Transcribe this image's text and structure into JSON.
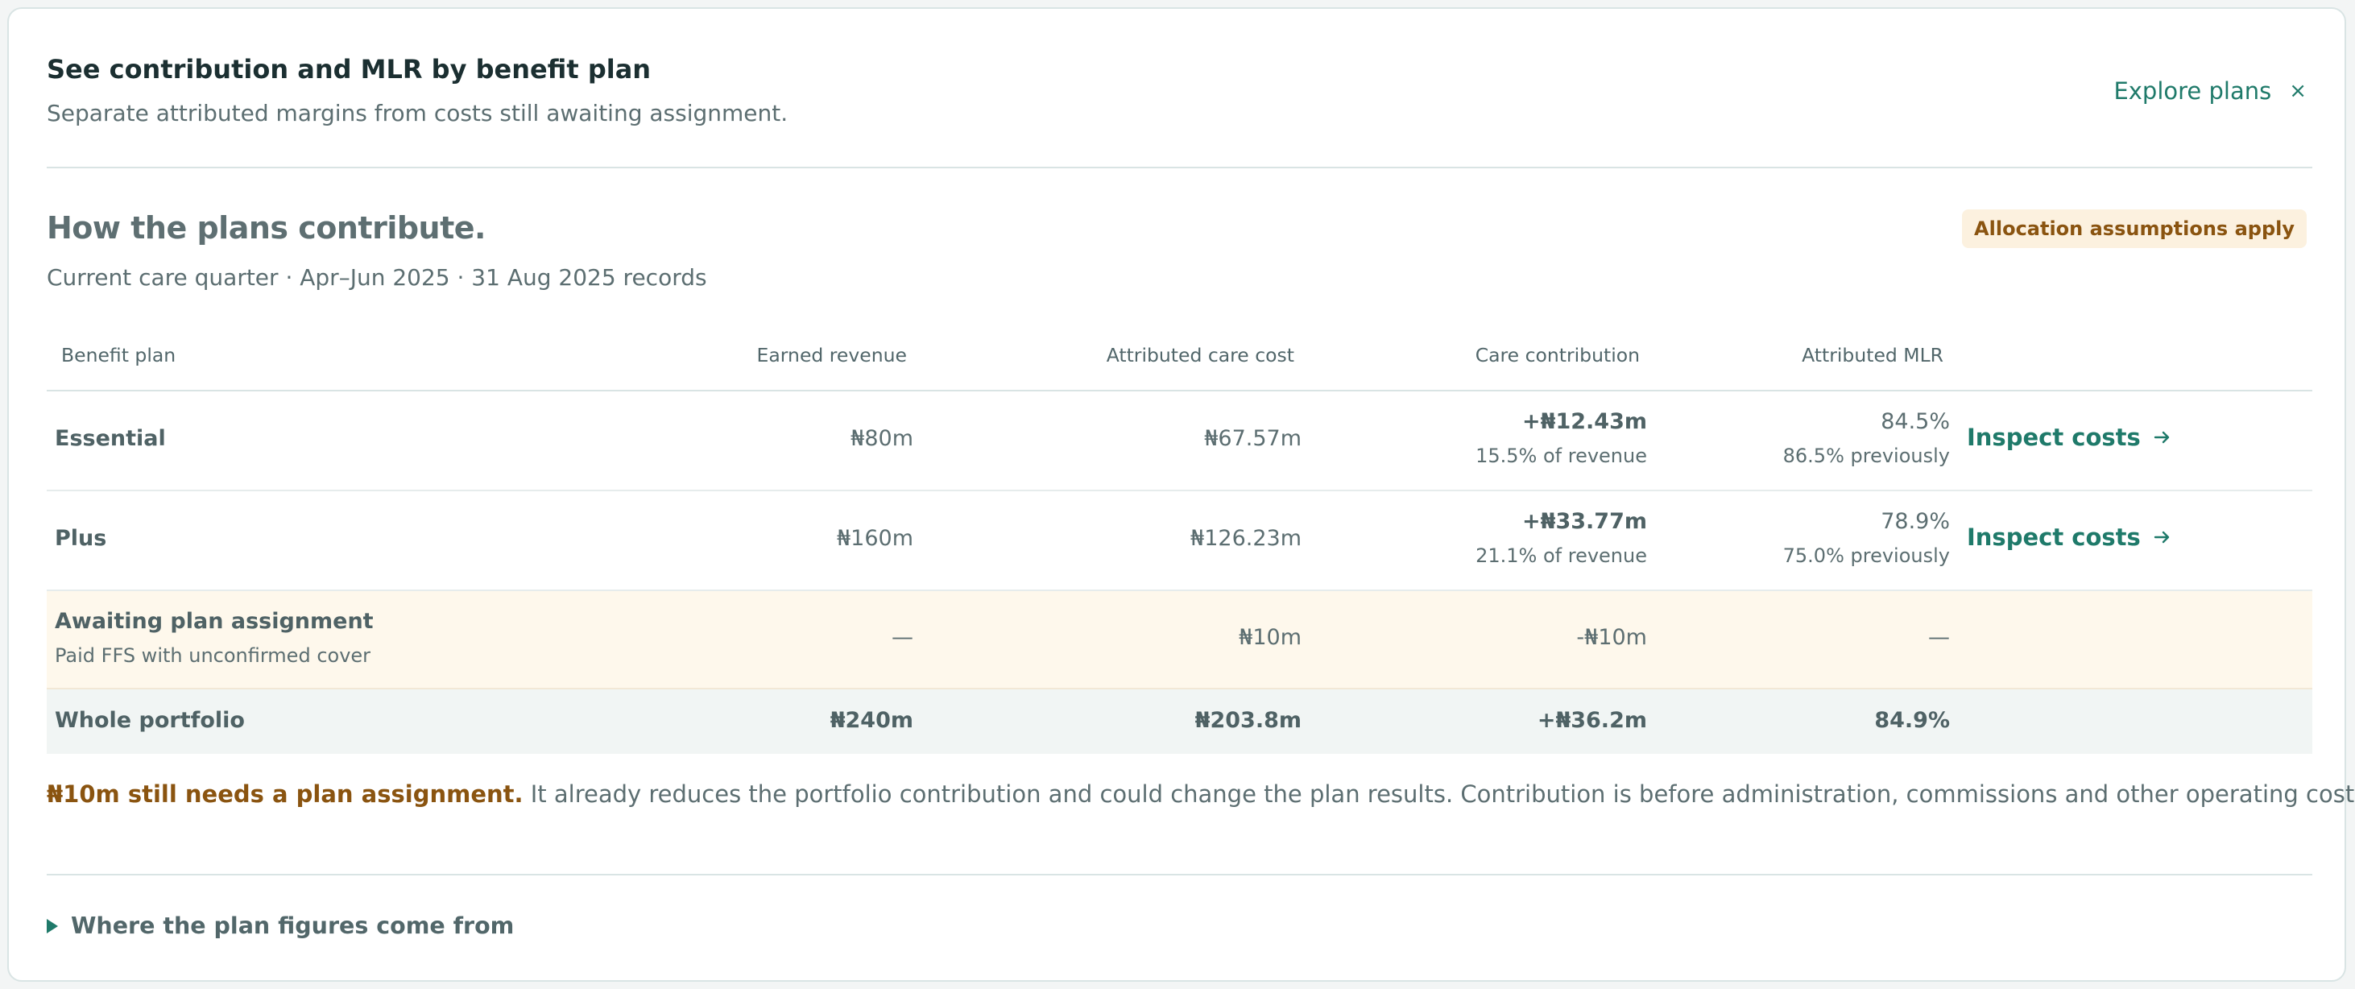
{
  "header": {
    "title": "See contribution and MLR by benefit plan",
    "subtitle": "Separate attributed margins from costs still awaiting assignment.",
    "explore_label": "Explore plans",
    "close_glyph": "×"
  },
  "section": {
    "title": "How the plans contribute.",
    "subtitle": "Current care quarter · Apr–Jun 2025 · 31 Aug 2025 records",
    "badge": "Allocation assumptions apply"
  },
  "table": {
    "columns": [
      "Benefit plan",
      "Earned revenue",
      "Attributed care cost",
      "Care contribution",
      "Attributed MLR"
    ],
    "rows": [
      {
        "plan": "Essential",
        "revenue": "₦80m",
        "cost": "₦67.57m",
        "contribution": "+₦12.43m",
        "contribution_note": "15.5% of revenue",
        "mlr": "84.5%",
        "mlr_note": "86.5% previously",
        "action": "Inspect costs"
      },
      {
        "plan": "Plus",
        "revenue": "₦160m",
        "cost": "₦126.23m",
        "contribution": "+₦33.77m",
        "contribution_note": "21.1% of revenue",
        "mlr": "78.9%",
        "mlr_note": "75.0% previously",
        "action": "Inspect costs"
      }
    ],
    "awaiting": {
      "plan": "Awaiting plan assignment",
      "plan_note": "Paid FFS with unconfirmed cover",
      "revenue": "—",
      "cost": "₦10m",
      "contribution": "-₦10m",
      "mlr": "—"
    },
    "total": {
      "plan": "Whole portfolio",
      "revenue": "₦240m",
      "cost": "₦203.8m",
      "contribution": "+₦36.2m",
      "mlr": "84.9%"
    }
  },
  "note": {
    "highlight": "₦10m still needs a plan assignment.",
    "text": " It already reduces the portfolio contribution and could change the plan results. Contribution is before administration, commissions and other operating costs."
  },
  "details": {
    "label": "Where the plan figures come from"
  },
  "colors": {
    "accent": "#1f7a6a",
    "warning_text": "#8a5410",
    "warning_bg": "#fcf1df"
  },
  "icons": [
    "close-icon",
    "arrow-right-icon",
    "disclosure-triangle-icon"
  ]
}
